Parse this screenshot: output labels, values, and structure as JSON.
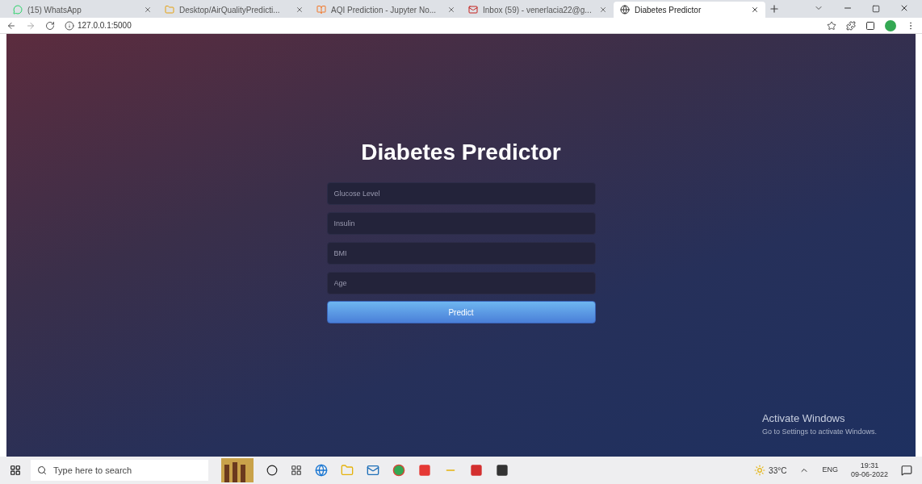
{
  "browser": {
    "tabs": [
      {
        "title": "(15) WhatsApp",
        "selected": false
      },
      {
        "title": "Desktop/AirQualityPredicti...",
        "selected": false
      },
      {
        "title": "AQI Prediction - Jupyter No...",
        "selected": false
      },
      {
        "title": "Inbox (59) - venerlacia22@g...",
        "selected": false
      },
      {
        "title": "Diabetes Predictor",
        "selected": true
      }
    ],
    "address": "127.0.0.1:5000"
  },
  "page": {
    "heading": "Diabetes Predictor",
    "fields": [
      {
        "placeholder": "Glucose Level"
      },
      {
        "placeholder": "Insulin"
      },
      {
        "placeholder": "BMI"
      },
      {
        "placeholder": "Age"
      }
    ],
    "submit": "Predict"
  },
  "activation": {
    "title": "Activate Windows",
    "subtitle": "Go to Settings to activate Windows."
  },
  "taskbar": {
    "search_placeholder": "Type here to search",
    "temperature": "33°C",
    "language": "ENG",
    "time": "19:31",
    "date": "09-06-2022"
  }
}
